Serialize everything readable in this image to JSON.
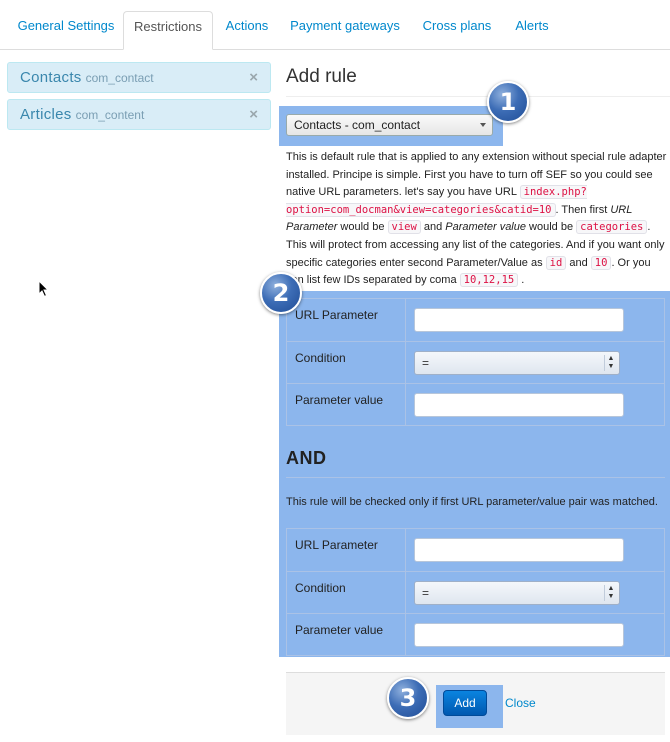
{
  "tabs": [
    "General Settings",
    "Restrictions",
    "Actions",
    "Payment gateways",
    "Cross plans",
    "Alerts"
  ],
  "sidebar": {
    "items": [
      {
        "title": "Contacts",
        "sub": "com_contact",
        "close": "×"
      },
      {
        "title": "Articles",
        "sub": "com_content",
        "close": "×"
      }
    ]
  },
  "main": {
    "heading": "Add rule",
    "extension_select": "Contacts - com_contact",
    "description": {
      "p1": "This is default rule that is applied to any extension without special rule adapter installed. Principe is simple. First you have to turn off SEF so you could see native URL parameters. let's say you have URL ",
      "code1": "index.php?option=com_docman&view=categories&catid=10",
      "p2": ". Then first ",
      "em1": "URL Parameter",
      "p3": " would be ",
      "code2": "view",
      "p4": " and ",
      "em2": "Parameter value",
      "p5": " would be ",
      "code3": "categories",
      "p6": ". This will protect from accessing any list of the categories. And if you want only specific categories enter second Parameter/Value as ",
      "code4": "id",
      "p7": " and ",
      "code5": "10",
      "p8": ". Or you can list few IDs separated by coma ",
      "code6": "10,12,15",
      "p9": " ."
    },
    "rule1": {
      "url_param_label": "URL Parameter",
      "condition_label": "Condition",
      "condition_value": "=",
      "param_value_label": "Parameter value",
      "url_param_value": "",
      "param_value": ""
    },
    "and_heading": "AND",
    "and_note": "This rule will be checked only if first URL parameter/value pair was matched.",
    "rule2": {
      "url_param_label": "URL Parameter",
      "condition_label": "Condition",
      "condition_value": "=",
      "param_value_label": "Parameter value",
      "url_param_value": "",
      "param_value": ""
    },
    "add_button": "Add",
    "close_link": "Close"
  },
  "badges": [
    "1",
    "2",
    "3"
  ]
}
